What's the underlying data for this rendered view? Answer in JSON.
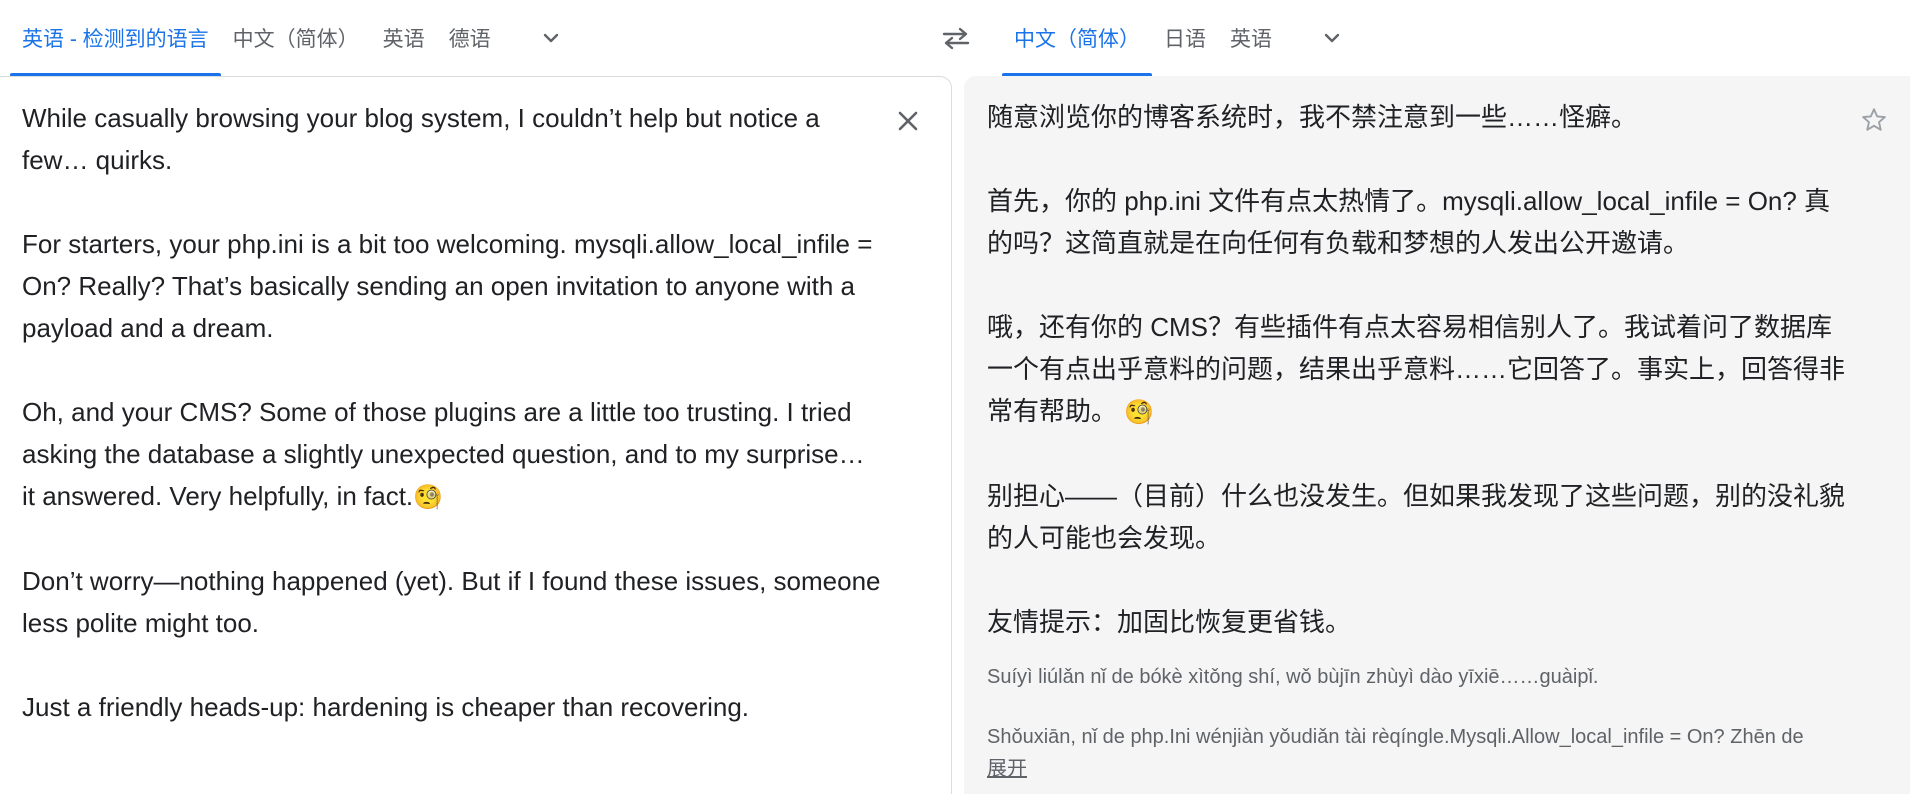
{
  "source_langs": {
    "tabs": [
      {
        "label": "英语 - 检测到的语言",
        "active": true
      },
      {
        "label": "中文（简体）",
        "active": false
      },
      {
        "label": "英语",
        "active": false
      },
      {
        "label": "德语",
        "active": false
      }
    ]
  },
  "target_langs": {
    "tabs": [
      {
        "label": "中文（简体）",
        "active": true
      },
      {
        "label": "日语",
        "active": false
      },
      {
        "label": "英语",
        "active": false
      }
    ]
  },
  "icons": {
    "more_source": "chevron-down-icon",
    "swap": "swap-languages-icon",
    "more_target": "chevron-down-icon",
    "clear": "close-icon",
    "save": "star-icon"
  },
  "colors": {
    "accent": "#1a73e8",
    "target_bg": "#f5f5f5",
    "muted": "#5f6368"
  },
  "source": {
    "paragraphs": [
      "While casually browsing your blog system, I couldn’t help but notice a few… quirks.",
      "For starters, your php.ini is a bit too welcoming. mysqli.allow_local_infile = On? Really? That’s basically sending an open invitation to anyone with a payload and a dream.",
      "Oh, and your CMS? Some of those plugins are a little too trusting. I tried asking the database a slightly unexpected question, and to my surprise… it answered. Very helpfully, in fact.",
      "Don’t worry—nothing happened (yet). But if I found these issues, someone less polite might too.",
      "Just a friendly heads-up: hardening is cheaper than recovering."
    ],
    "emoji": "🧐"
  },
  "target": {
    "paragraphs": [
      "随意浏览你的博客系统时，我不禁注意到一些……怪癖。",
      "首先，你的 php.ini 文件有点太热情了。mysqli.allow_local_infile = On? 真的吗？这简直就是在向任何有负载和梦想的人发出公开邀请。",
      "哦，还有你的 CMS？有些插件有点太容易相信别人了。我试着问了数据库一个有点出乎意料的问题，结果出乎意料……它回答了。事实上，回答得非常有帮助。",
      "别担心——（目前）什么也没发生。但如果我发现了这些问题，别的没礼貌的人可能也会发现。",
      "友情提示：加固比恢复更省钱。"
    ],
    "emoji": "🧐",
    "transliteration": [
      "Suíyì liúlǎn nǐ de bókè xìtǒng shí, wǒ bùjīn zhùyì dào yīxiē……guàipǐ.",
      "Shǒuxiān, nǐ de php.Ini wénjiàn yǒudiǎn tài rèqíngle.Mysqli.Allow_local_infile = On? Zhēn de"
    ],
    "expand_label": "展开"
  }
}
